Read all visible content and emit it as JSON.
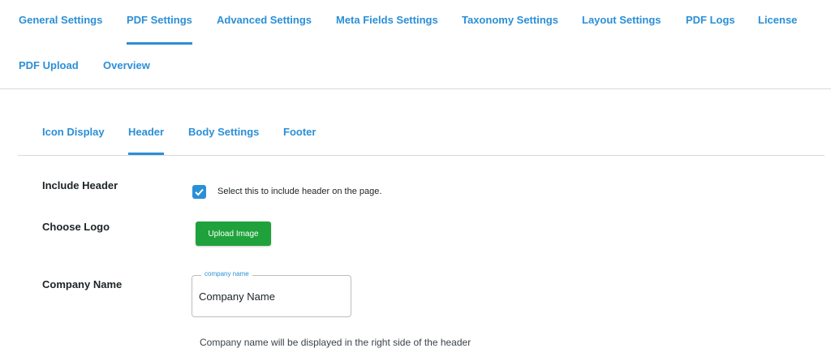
{
  "top_tabs": [
    {
      "label": "General Settings",
      "active": false
    },
    {
      "label": "PDF Settings",
      "active": true
    },
    {
      "label": "Advanced Settings",
      "active": false
    },
    {
      "label": "Meta Fields Settings",
      "active": false
    },
    {
      "label": "Taxonomy Settings",
      "active": false
    },
    {
      "label": "Layout Settings",
      "active": false
    },
    {
      "label": "PDF Logs",
      "active": false
    },
    {
      "label": "License",
      "active": false
    },
    {
      "label": "PDF Upload",
      "active": false
    },
    {
      "label": "Overview",
      "active": false
    }
  ],
  "sub_tabs": [
    {
      "label": "Icon Display",
      "active": false
    },
    {
      "label": "Header",
      "active": true
    },
    {
      "label": "Body Settings",
      "active": false
    },
    {
      "label": "Footer",
      "active": false
    }
  ],
  "form": {
    "include_header": {
      "label": "Include Header",
      "checked": true,
      "description": "Select this to include header on the page."
    },
    "choose_logo": {
      "label": "Choose Logo",
      "button_label": "Upload Image"
    },
    "company_name": {
      "label": "Company Name",
      "legend": "company name",
      "value": "Company Name",
      "help": "Company name will be displayed in the right side of the header"
    }
  },
  "colors": {
    "accent": "#2b8fd6",
    "button": "#1fa23b"
  }
}
